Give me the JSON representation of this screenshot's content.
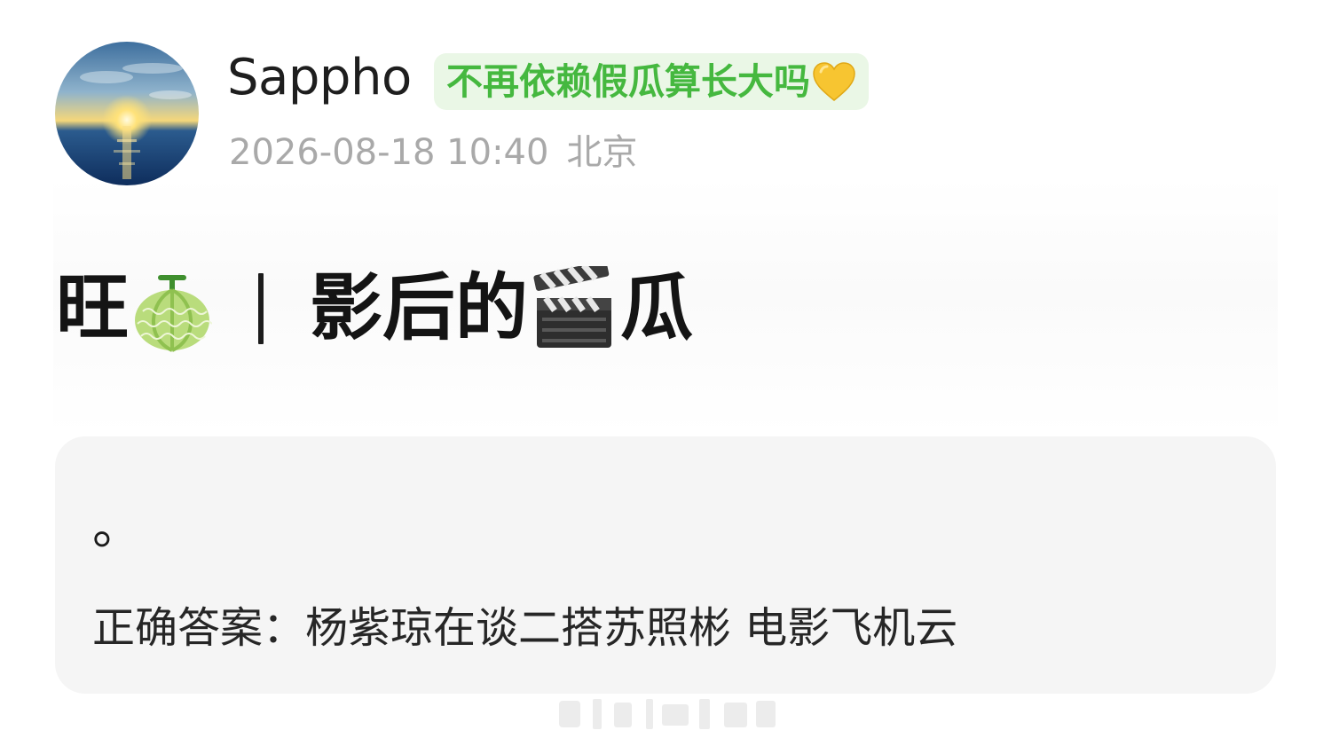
{
  "post": {
    "author": {
      "name": "Sappho",
      "badge_text": "不再依赖假瓜算长大吗",
      "badge_emoji_icon": "yellow-heart-icon"
    },
    "meta": {
      "datetime": "2026-08-18 10:40",
      "location": "北京"
    },
    "title": {
      "part1": "旺",
      "icon1": "melon-icon",
      "part2": "影后的",
      "icon2": "clapper-board-icon",
      "part3": "瓜"
    },
    "card": {
      "line1": "。",
      "line2": "正确答案：杨紫琼在谈二搭苏照彬 电影飞机云"
    }
  },
  "colors": {
    "badge_bg": "#eaf7e6",
    "badge_text": "#45b83f",
    "meta_text": "#a9a9a9",
    "card_bg": "#f5f5f5"
  }
}
